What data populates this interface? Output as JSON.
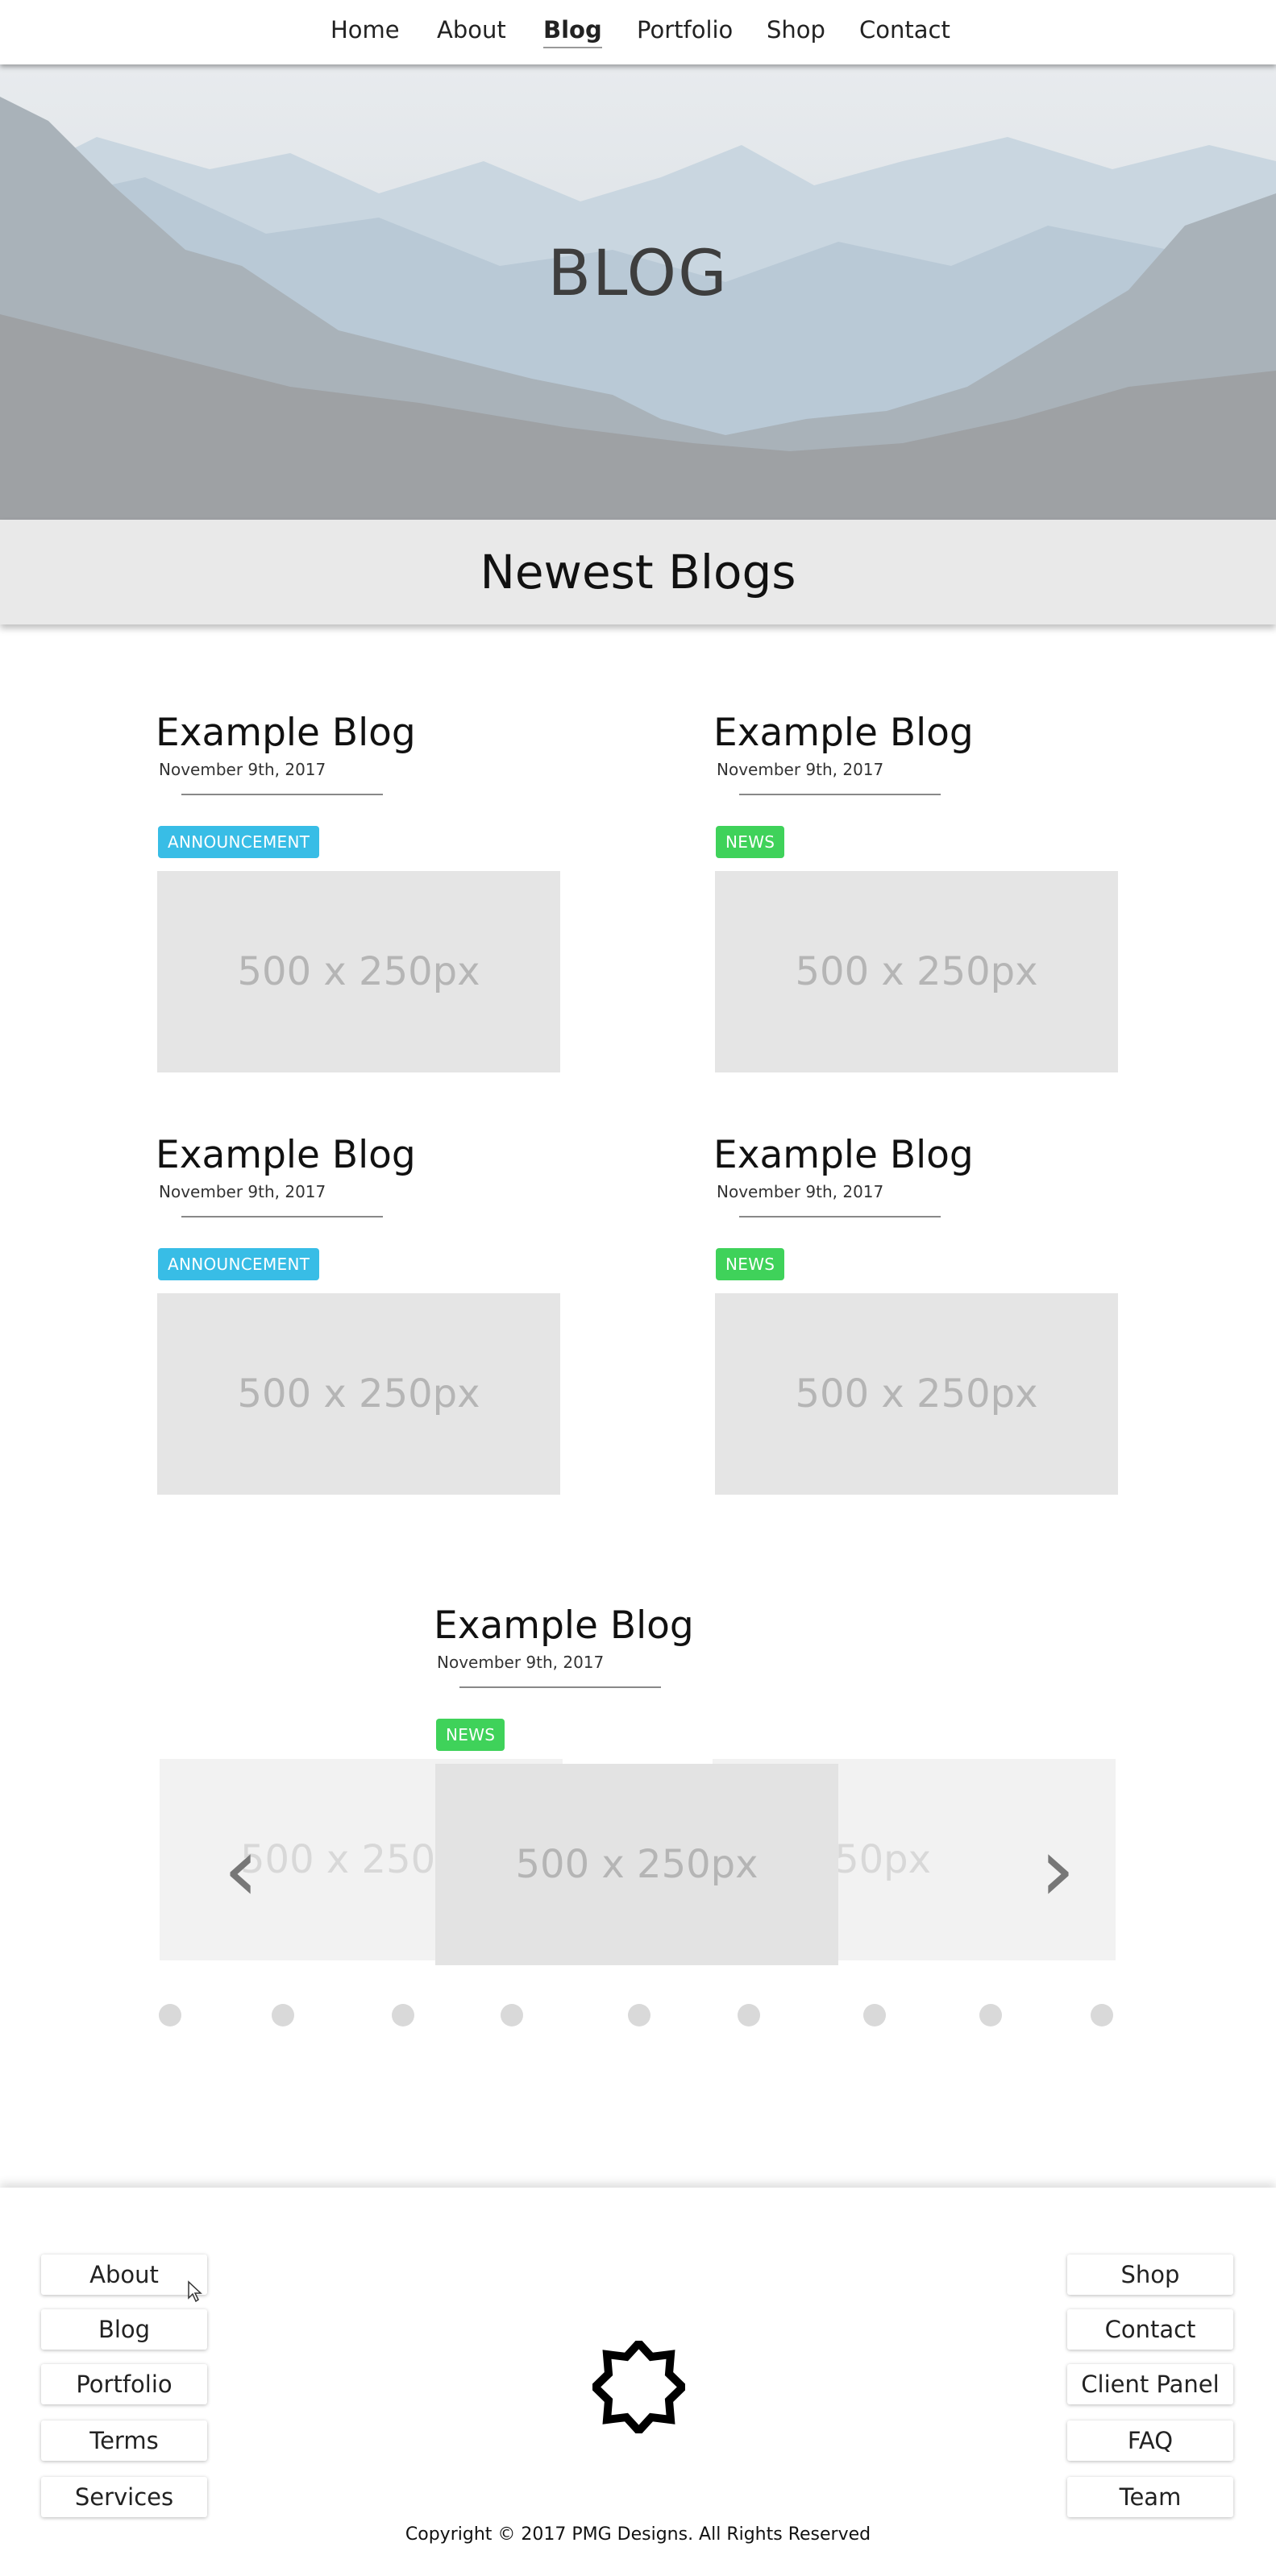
{
  "nav": {
    "items": [
      {
        "label": "Home"
      },
      {
        "label": "About"
      },
      {
        "label": "Blog",
        "active": true
      },
      {
        "label": "Portfolio"
      },
      {
        "label": "Shop"
      },
      {
        "label": "Contact"
      }
    ]
  },
  "hero": {
    "title": "BLOG"
  },
  "section": {
    "title": "Newest Blogs"
  },
  "posts": [
    {
      "title": "Example Blog",
      "date": "November 9th, 2017",
      "tag": "ANNOUNCEMENT",
      "image": "500 x 250px"
    },
    {
      "title": "Example Blog",
      "date": "November 9th, 2017",
      "tag": "NEWS",
      "image": "500 x 250px"
    },
    {
      "title": "Example Blog",
      "date": "November 9th, 2017",
      "tag": "ANNOUNCEMENT",
      "image": "500 x 250px"
    },
    {
      "title": "Example Blog",
      "date": "November 9th, 2017",
      "tag": "NEWS",
      "image": "500 x 250px"
    }
  ],
  "carousel": {
    "active": {
      "title": "Example Blog",
      "date": "November 9th, 2017",
      "tag": "NEWS",
      "image": "500 x 250px"
    },
    "prev_image": "500 x 250px",
    "next_image": "500 x 250px",
    "prev_arrow": "‹",
    "next_arrow": "›",
    "dot_count": 9
  },
  "colors": {
    "announcement": "#38bde6",
    "news": "#3fd25a"
  },
  "footer": {
    "left_links": [
      "About",
      "Blog",
      "Portfolio",
      "Terms",
      "Services"
    ],
    "right_links": [
      "Shop",
      "Contact",
      "Client Panel",
      "FAQ",
      "Team"
    ],
    "logo_icon": "star-outline-icon",
    "copyright": "Copyright © 2017 PMG Designs. All Rights Reserved"
  }
}
